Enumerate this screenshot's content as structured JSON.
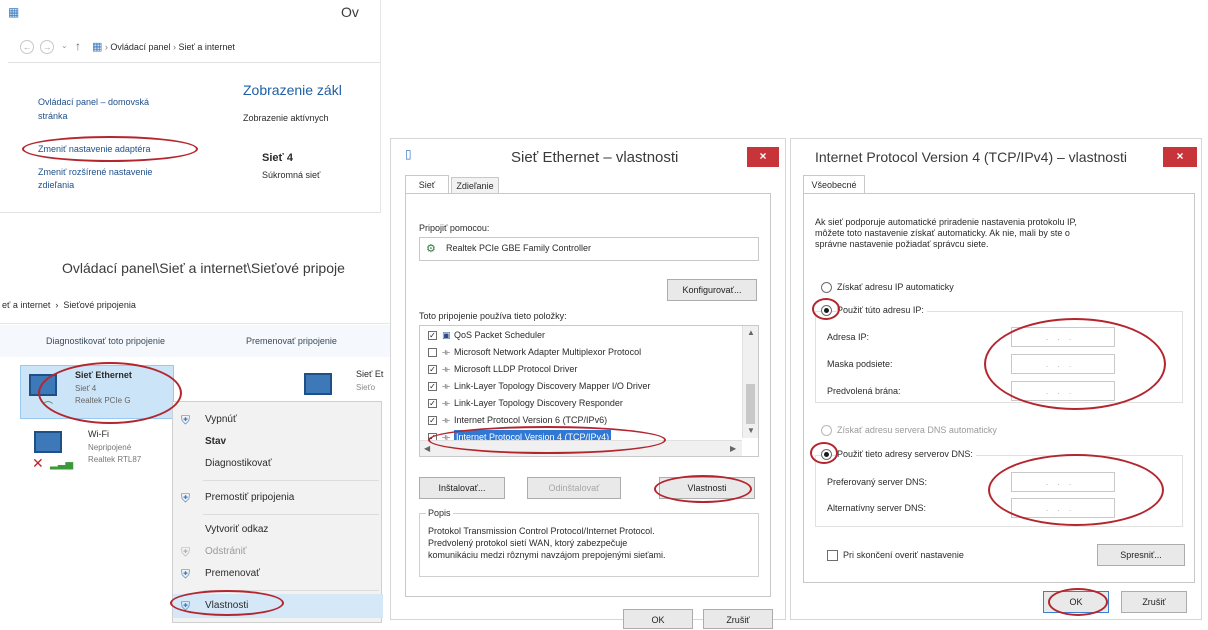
{
  "control_panel": {
    "title": "Ov",
    "breadcrumb": [
      "Ovládací panel",
      "Sieť a internet"
    ],
    "heading": "Zobrazenie zákl",
    "sub_heading": "Zobrazenie aktívnych",
    "home_link_line1": "Ovládací panel – domovská",
    "home_link_line2": "stránka",
    "change_adapter_link": "Zmeniť nastavenie adaptéra",
    "advanced_sharing_line1": "Zmeniť rozšírené nastavenie",
    "advanced_sharing_line2": "zdieľania",
    "network_name": "Sieť 4",
    "network_type": "Súkromná sieť"
  },
  "network_connections": {
    "title": "Ovládací panel\\Sieť a internet\\Sieťové pripoje",
    "breadcrumb": "eť a internet  ›  Sieťové pripojenia",
    "toolbar": {
      "diagnose": "Diagnostikovať toto pripojenie",
      "rename": "Premenovať pripojenie"
    },
    "adapters": [
      {
        "name": "Sieť Ethernet",
        "network": "Sieť 4",
        "device": "Realtek PCIe G"
      },
      {
        "name": "Wi-Fi",
        "network": "Nepripojené",
        "device": "Realtek RTL87"
      }
    ],
    "partial_adapter": {
      "name": "Sieť Et",
      "network": "Sieťo"
    },
    "context_menu": [
      "Vypnúť",
      "Stav",
      "Diagnostikovať",
      "Premostiť pripojenia",
      "Vytvoriť odkaz",
      "Odstrániť",
      "Premenovať",
      "Vlastnosti"
    ]
  },
  "ethernet_properties": {
    "title": "Sieť Ethernet – vlastnosti",
    "close": "×",
    "tabs": [
      "Sieť",
      "Zdieľanie"
    ],
    "connect_using_label": "Pripojiť pomocou:",
    "adapter_name": "Realtek PCIe GBE Family Controller",
    "configure_button": "Konfigurovať...",
    "items_label": "Toto pripojenie používa tieto položky:",
    "items": [
      {
        "label": "QoS Packet Scheduler",
        "checked": true
      },
      {
        "label": "Microsoft Network Adapter Multiplexor Protocol",
        "checked": false
      },
      {
        "label": "Microsoft LLDP Protocol Driver",
        "checked": true
      },
      {
        "label": "Link-Layer Topology Discovery Mapper I/O Driver",
        "checked": true
      },
      {
        "label": "Link-Layer Topology Discovery Responder",
        "checked": true
      },
      {
        "label": "Internet Protocol Version 6 (TCP/IPv6)",
        "checked": true
      },
      {
        "label": "Internet Protocol Version 4 (TCP/IPv4)",
        "checked": true
      }
    ],
    "install_button": "Inštalovať...",
    "uninstall_button": "Odinštalovať",
    "properties_button": "Vlastnosti",
    "description_label": "Popis",
    "description_lines": [
      "Protokol Transmission Control Protocol/Internet Protocol.",
      "Predvolený protokol sietí WAN, ktorý zabezpečuje",
      "komunikáciu medzi rôznymi navzájom prepojenými sieťami."
    ],
    "ok_button": "OK",
    "cancel_button": "Zrušiť"
  },
  "ipv4_properties": {
    "title": "Internet Protocol Version 4 (TCP/IPv4) – vlastnosti",
    "close": "×",
    "tab": "Všeobecné",
    "intro_lines": [
      "Ak sieť podporuje automatické priradenie nastavenia protokolu IP,",
      "môžete toto nastavenie získať automaticky. Ak nie, mali by ste o",
      "správne nastavenie požiadať správcu siete."
    ],
    "auto_ip": "Získať adresu IP automaticky",
    "use_ip": "Použiť túto adresu IP:",
    "ip_address_label": "Adresa IP:",
    "subnet_label": "Maska podsiete:",
    "gateway_label": "Predvolená brána:",
    "auto_dns": "Získať adresu servera DNS automaticky",
    "use_dns": "Použiť tieto adresy serverov DNS:",
    "preferred_dns_label": "Preferovaný server DNS:",
    "alternate_dns_label": "Alternatívny server DNS:",
    "ip_placeholder": "...",
    "validate_checkbox": "Pri skončení overiť nastavenie",
    "advanced_button": "Spresniť...",
    "ok_button": "OK",
    "cancel_button": "Zrušiť"
  }
}
